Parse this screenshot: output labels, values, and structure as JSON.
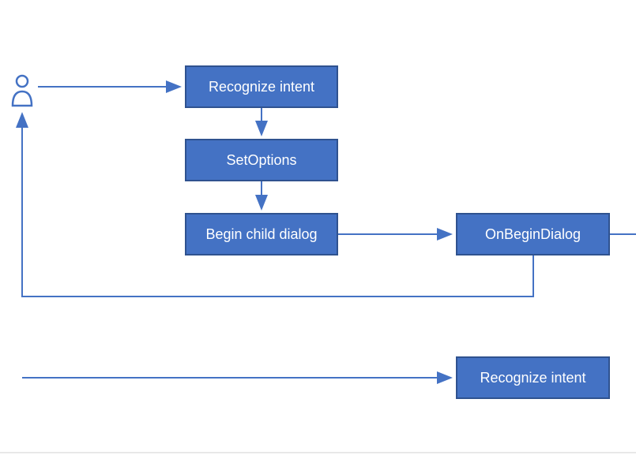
{
  "nodes": {
    "recognize_intent_1": "Recognize intent",
    "set_options": "SetOptions",
    "begin_child_dialog": "Begin child dialog",
    "on_begin_dialog": "OnBeginDialog",
    "recognize_intent_2": "Recognize intent"
  },
  "icon": "user-icon",
  "colors": {
    "box_fill": "#4472C4",
    "box_border": "#2F528F",
    "arrow": "#4472C4",
    "arrow2": "#4472C4"
  }
}
